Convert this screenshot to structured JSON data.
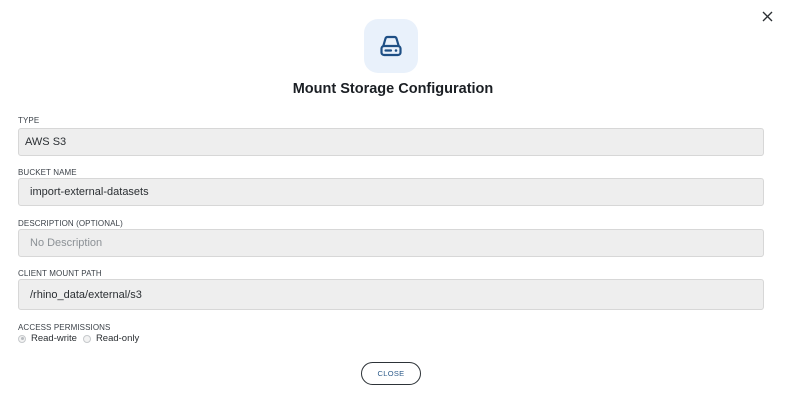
{
  "dialog": {
    "title": "Mount Storage Configuration",
    "header_icon": "hard-drive-icon",
    "close_icon": "close-icon",
    "accent_color": "#2d5b8a"
  },
  "fields": {
    "type": {
      "label": "TYPE",
      "value": "AWS S3"
    },
    "bucket_name": {
      "label": "BUCKET NAME",
      "value": "import-external-datasets"
    },
    "description": {
      "label": "DESCRIPTION (OPTIONAL)",
      "value": "No Description"
    },
    "client_mount_path": {
      "label": "CLIENT MOUNT PATH",
      "value": "/rhino_data/external/s3"
    }
  },
  "access": {
    "label": "ACCESS PERMISSIONS",
    "options": [
      {
        "label": "Read-write",
        "selected": true
      },
      {
        "label": "Read-only",
        "selected": false
      }
    ]
  },
  "footer": {
    "close_label": "CLOSE"
  }
}
